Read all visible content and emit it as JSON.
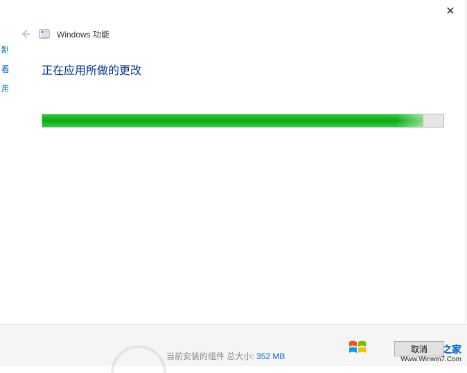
{
  "bg": {
    "frag1": "制",
    "frag2": "看",
    "frag3": "用"
  },
  "dialog": {
    "close_glyph": "✕",
    "back_glyph": "←",
    "app_title": "Windows 功能",
    "heading": "正在应用所做的更改",
    "progress_percent": 95,
    "cancel_label": "取消"
  },
  "bottom": {
    "status_label": "当前安装的组件",
    "status_mid": "总大小:",
    "status_value": "352 MB"
  },
  "watermark": {
    "title": "Win7系统之家",
    "url": "Www.Winwin7.Com"
  }
}
